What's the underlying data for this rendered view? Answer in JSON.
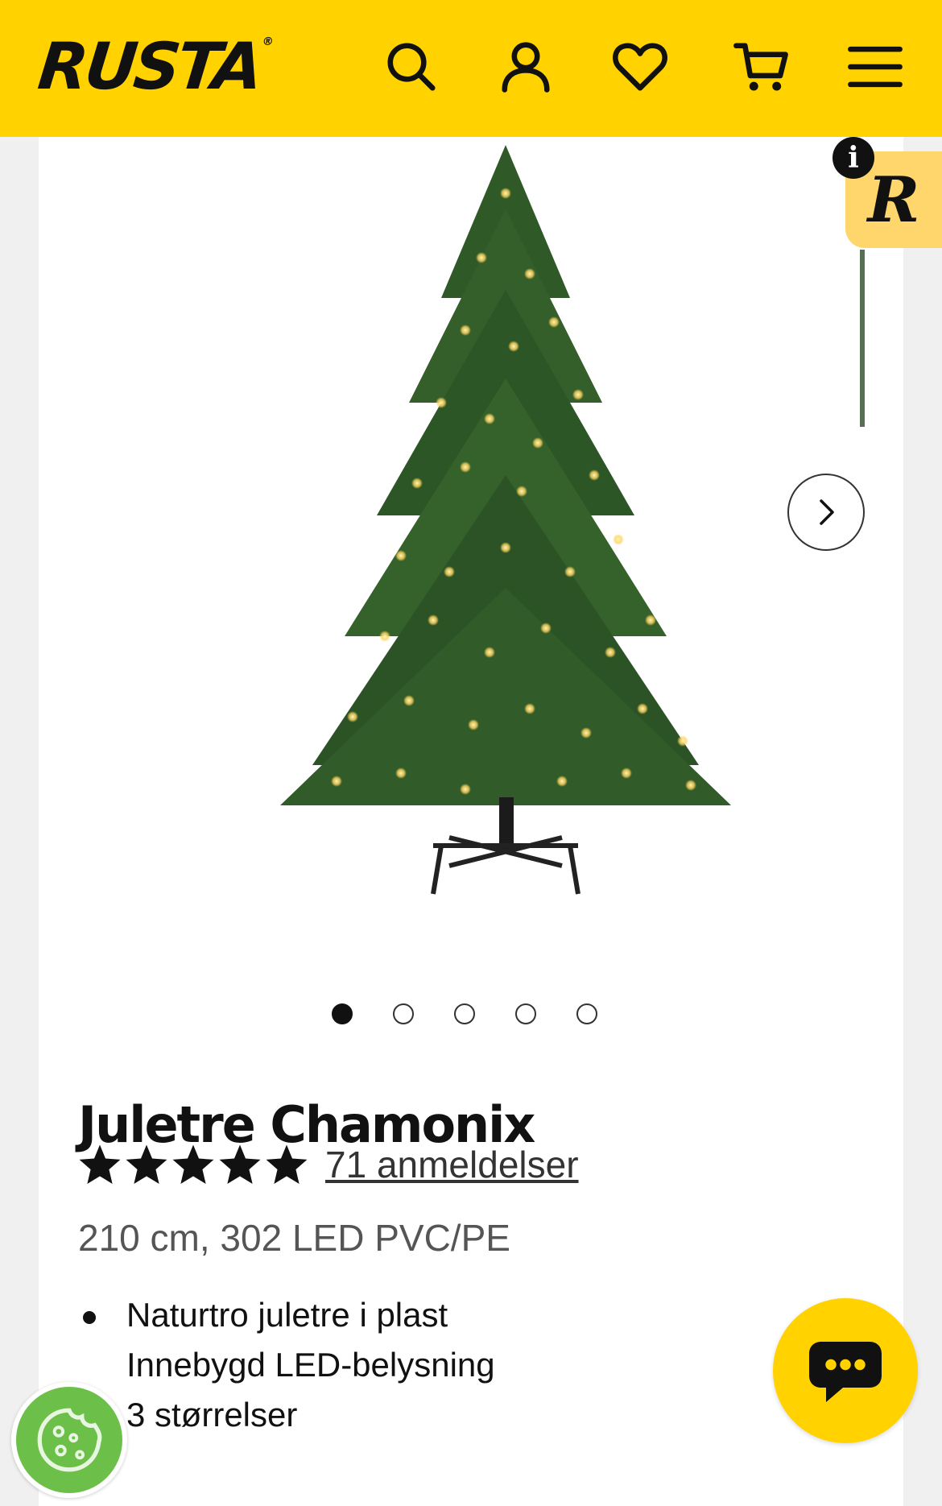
{
  "header": {
    "logo_text": "RUSTA",
    "logo_mark": "®",
    "icons": [
      "search-icon",
      "account-icon",
      "heart-icon",
      "cart-icon",
      "menu-icon"
    ],
    "background_color": "#ffd200"
  },
  "gallery": {
    "image": "christmas-tree-image",
    "slide_count": 5,
    "active_slide": 1,
    "next_icon": "chevron-right-icon"
  },
  "product": {
    "title": "Juletre Chamonix",
    "rating_stars": 5,
    "reviews_label": "71 anmeldelser",
    "subtitle": "210 cm, 302 LED PVC/PE",
    "features": [
      "Naturtro juletre i plast",
      "Innebygd LED-belysning",
      "3 størrelser"
    ]
  },
  "widgets": {
    "info_badge": "i",
    "r_badge": "R",
    "chat_icon": "chat-bubble-icon",
    "cookie_icon": "cookie-icon",
    "accent_yellow": "#ffd200",
    "cookie_green": "#6cc04a"
  }
}
